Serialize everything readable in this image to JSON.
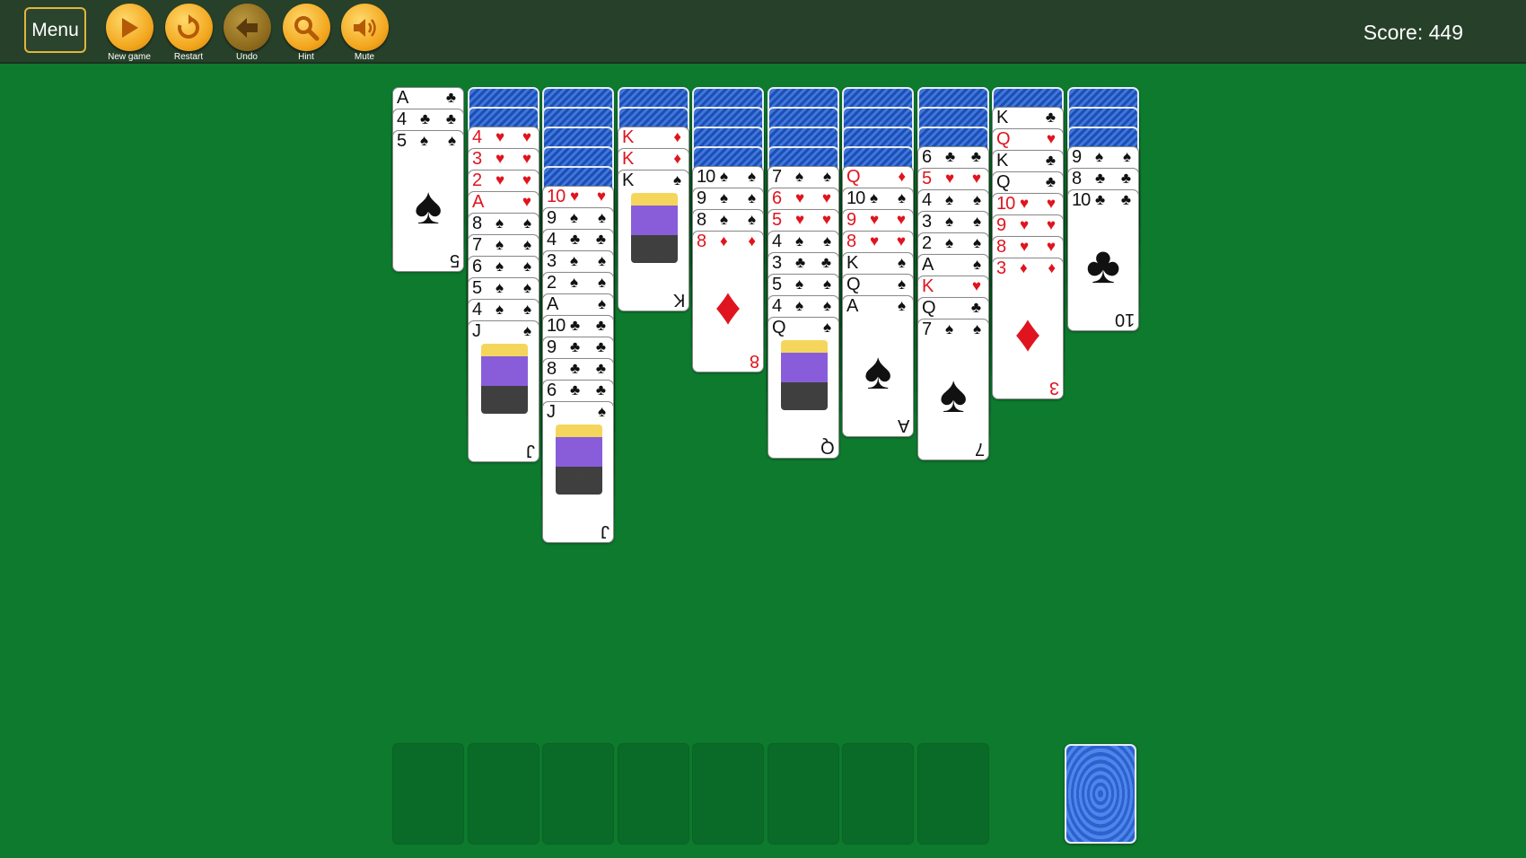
{
  "toolbar": {
    "menu_label": "Menu",
    "buttons": [
      {
        "label": "New game",
        "icon": "play-icon"
      },
      {
        "label": "Restart",
        "icon": "restart-icon"
      },
      {
        "label": "Undo",
        "icon": "undo-arrow-icon"
      },
      {
        "label": "Hint",
        "icon": "magnifier-icon"
      },
      {
        "label": "Mute",
        "icon": "speaker-icon"
      }
    ],
    "score": "Score: 449"
  },
  "colors": {
    "felt": "#0d7a2e",
    "topbar": "#27402a",
    "button": "#f2a51c",
    "card_back": "#2c62cf",
    "red_suit": "#e0141e"
  },
  "tableau": [
    {
      "face_down": 0,
      "face_up": [
        [
          "A",
          "♣"
        ],
        [
          "4",
          "♣"
        ],
        [
          "5",
          "♠"
        ]
      ]
    },
    {
      "face_down": 2,
      "face_up": [
        [
          "4",
          "♥"
        ],
        [
          "3",
          "♥"
        ],
        [
          "2",
          "♥"
        ],
        [
          "A",
          "♥"
        ],
        [
          "8",
          "♠"
        ],
        [
          "7",
          "♠"
        ],
        [
          "6",
          "♠"
        ],
        [
          "5",
          "♠"
        ],
        [
          "4",
          "♠"
        ],
        [
          "J",
          "♠"
        ]
      ]
    },
    {
      "face_down": 5,
      "face_up": [
        [
          "10",
          "♥"
        ],
        [
          "9",
          "♠"
        ],
        [
          "4",
          "♣"
        ],
        [
          "3",
          "♠"
        ],
        [
          "2",
          "♠"
        ],
        [
          "A",
          "♠"
        ],
        [
          "10",
          "♣"
        ],
        [
          "9",
          "♣"
        ],
        [
          "8",
          "♣"
        ],
        [
          "6",
          "♣"
        ],
        [
          "J",
          "♠"
        ]
      ]
    },
    {
      "face_down": 2,
      "face_up": [
        [
          "K",
          "♦"
        ],
        [
          "K",
          "♦"
        ],
        [
          "K",
          "♠"
        ]
      ]
    },
    {
      "face_down": 4,
      "face_up": [
        [
          "10",
          "♠"
        ],
        [
          "9",
          "♠"
        ],
        [
          "8",
          "♠"
        ],
        [
          "8",
          "♦"
        ]
      ]
    },
    {
      "face_down": 4,
      "face_up": [
        [
          "7",
          "♠"
        ],
        [
          "6",
          "♥"
        ],
        [
          "5",
          "♥"
        ],
        [
          "4",
          "♠"
        ],
        [
          "3",
          "♣"
        ],
        [
          "5",
          "♠"
        ],
        [
          "4",
          "♠"
        ],
        [
          "Q",
          "♠"
        ]
      ]
    },
    {
      "face_down": 4,
      "face_up": [
        [
          "Q",
          "♦"
        ],
        [
          "10",
          "♠"
        ],
        [
          "9",
          "♥"
        ],
        [
          "8",
          "♥"
        ],
        [
          "K",
          "♠"
        ],
        [
          "Q",
          "♠"
        ],
        [
          "A",
          "♠"
        ]
      ]
    },
    {
      "face_down": 3,
      "face_up": [
        [
          "6",
          "♣"
        ],
        [
          "5",
          "♥"
        ],
        [
          "4",
          "♠"
        ],
        [
          "3",
          "♠"
        ],
        [
          "2",
          "♠"
        ],
        [
          "A",
          "♠"
        ],
        [
          "K",
          "♥"
        ],
        [
          "Q",
          "♣"
        ],
        [
          "7",
          "♠"
        ]
      ]
    },
    {
      "face_down": 1,
      "face_up": [
        [
          "K",
          "♣"
        ],
        [
          "Q",
          "♥"
        ],
        [
          "K",
          "♣"
        ],
        [
          "Q",
          "♣"
        ],
        [
          "10",
          "♥"
        ],
        [
          "9",
          "♥"
        ],
        [
          "8",
          "♥"
        ],
        [
          "3",
          "♦"
        ]
      ]
    },
    {
      "face_down": 3,
      "face_up": [
        [
          "9",
          "♠"
        ],
        [
          "8",
          "♣"
        ],
        [
          "10",
          "♣"
        ]
      ]
    }
  ],
  "foundation_slots": 8,
  "stock_piles": 1
}
